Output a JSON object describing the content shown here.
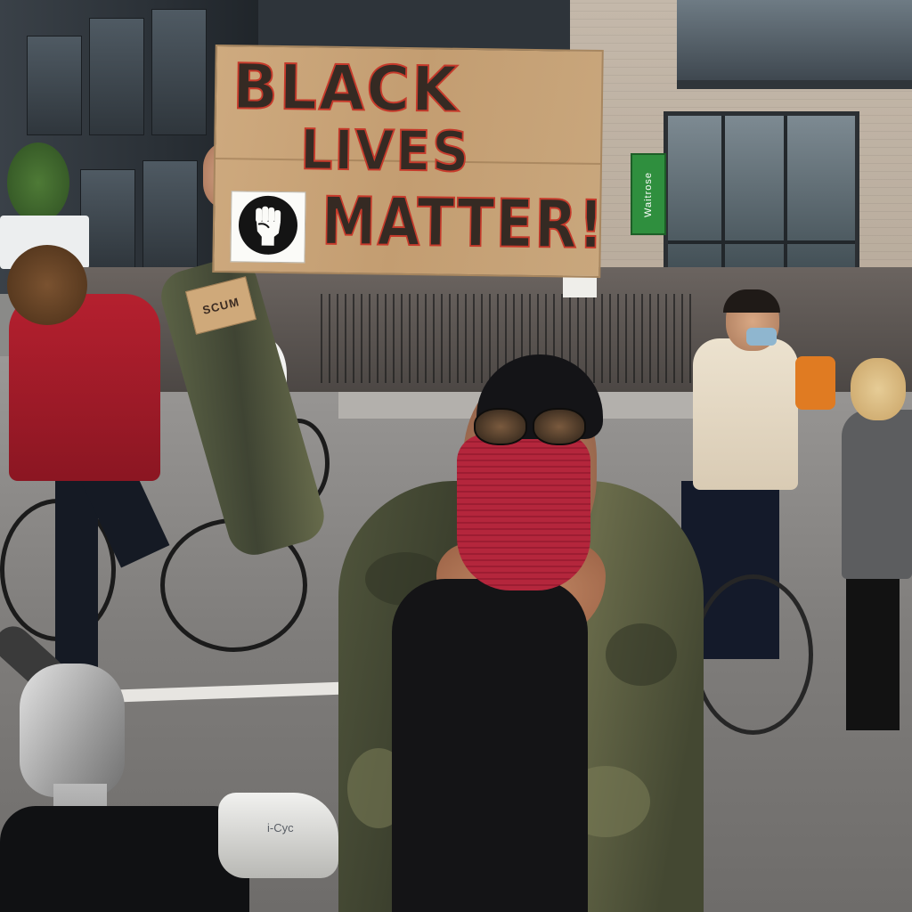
{
  "scene": {
    "sign": {
      "line1": "BLACK",
      "line2": "LIVES",
      "line3": "MATTER!",
      "emblem": "raised-fist-icon"
    },
    "small_sign_text": "SCUM",
    "store_sign_text": "Waitrose",
    "bike_brand_text": "i-Cyc",
    "colors": {
      "cardboard": "#c7a276",
      "sign_text": "#352a23",
      "sign_outline": "#c63a2b",
      "bandana": "#b4263c",
      "camo_jacket": "#50553c",
      "red_jacket": "#b5202f",
      "store_sign": "#2f8f3e"
    }
  }
}
